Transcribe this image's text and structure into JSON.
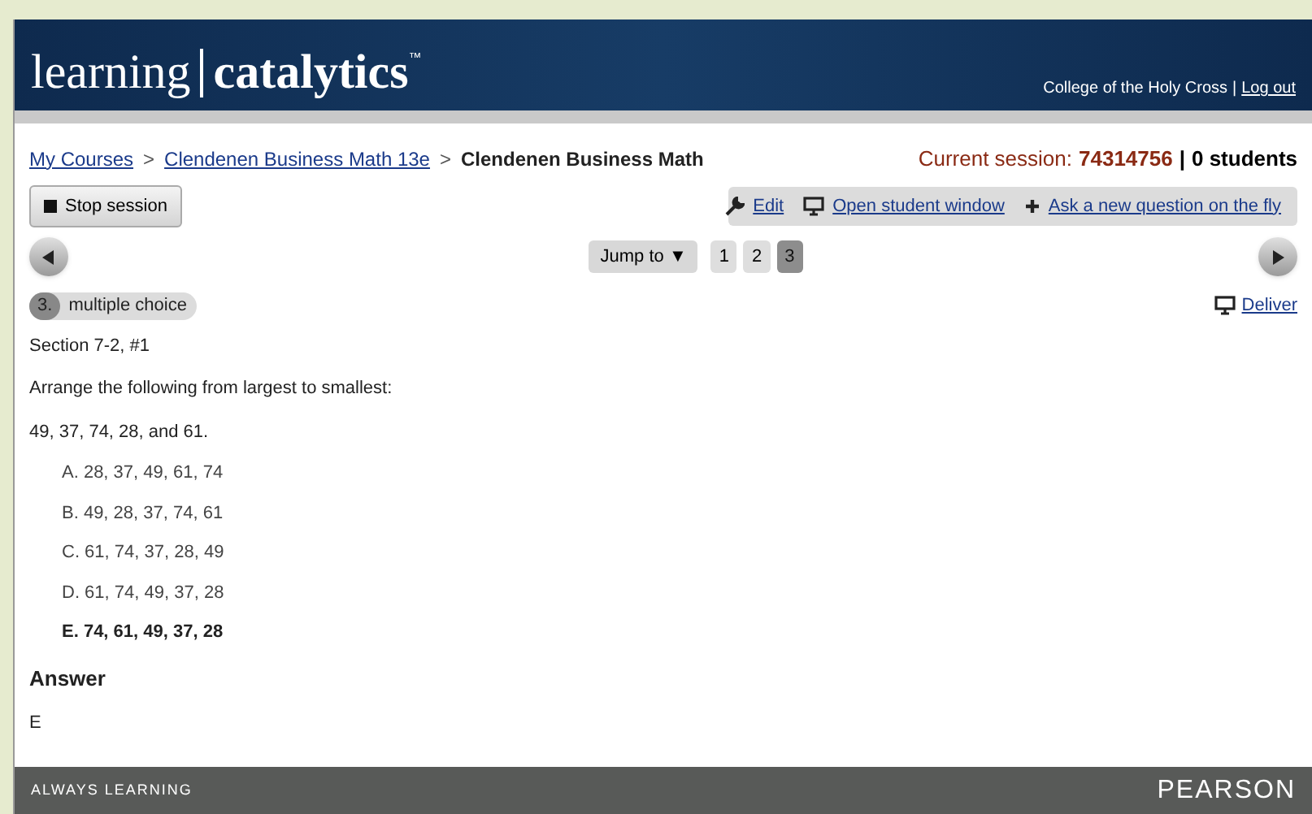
{
  "header": {
    "logo_light": "learning",
    "logo_bold": "catalytics",
    "logo_mark": "™",
    "institution": "College of the Holy Cross",
    "separator": "|",
    "logout": "Log out"
  },
  "breadcrumb": [
    {
      "label": "My Courses",
      "kind": "link"
    },
    {
      "label": ">",
      "kind": "sep"
    },
    {
      "label": "Clendenen Business Math 13e",
      "kind": "link"
    },
    {
      "label": ">",
      "kind": "sep"
    },
    {
      "label": "Clendenen Business Math",
      "kind": "current"
    }
  ],
  "session": {
    "label": "Current session:",
    "code": "74314756",
    "separator": "|",
    "students": "0 students"
  },
  "stop_button": "Stop session",
  "toolbar": [
    {
      "label": "Edit",
      "kind": "edit"
    },
    {
      "label": "Open student window",
      "kind": "window"
    },
    {
      "label": "Ask a new question on the fly",
      "kind": "add"
    }
  ],
  "jump": "Jump to ▼",
  "pages": [
    {
      "label": "1",
      "selected": false
    },
    {
      "label": "2",
      "selected": false
    },
    {
      "label": "3",
      "selected": true
    }
  ],
  "question": {
    "number": "3.",
    "type": "multiple choice",
    "deliver": "Deliver",
    "section": "Section 7-2, #1",
    "prompt": "Arrange the following from largest to smallest:",
    "numbers": "49, 37, 74, 28, and 61.",
    "choices": [
      {
        "label": "A. 28, 37, 49, 61, 74",
        "correct": false
      },
      {
        "label": "B. 49, 28, 37, 74, 61",
        "correct": false
      },
      {
        "label": "C. 61, 74, 37, 28, 49",
        "correct": false
      },
      {
        "label": "D. 61, 74, 49, 37, 28",
        "correct": false
      },
      {
        "label": "E. 74, 61, 49, 37, 28",
        "correct": true
      }
    ],
    "answer_heading": "Answer",
    "answer": "E"
  },
  "footer": {
    "left": "ALWAYS LEARNING",
    "right": "PEARSON"
  }
}
